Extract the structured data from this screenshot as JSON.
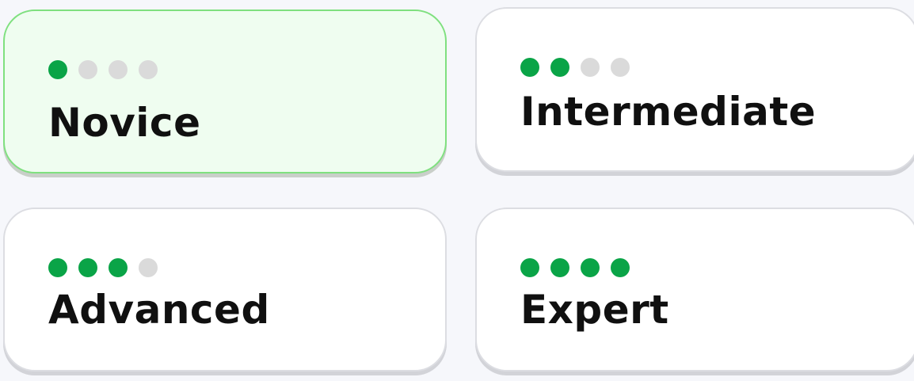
{
  "levels": [
    {
      "label": "Novice",
      "filled": 1,
      "total": 4,
      "selected": true
    },
    {
      "label": "Intermediate",
      "filled": 2,
      "total": 4,
      "selected": false
    },
    {
      "label": "Advanced",
      "filled": 3,
      "total": 4,
      "selected": false
    },
    {
      "label": "Expert",
      "filled": 4,
      "total": 4,
      "selected": false
    }
  ],
  "colors": {
    "dot_filled": "#0aa447",
    "dot_empty": "#dadada",
    "selected_background": "#effdf0",
    "selected_border": "#7fe07f"
  }
}
